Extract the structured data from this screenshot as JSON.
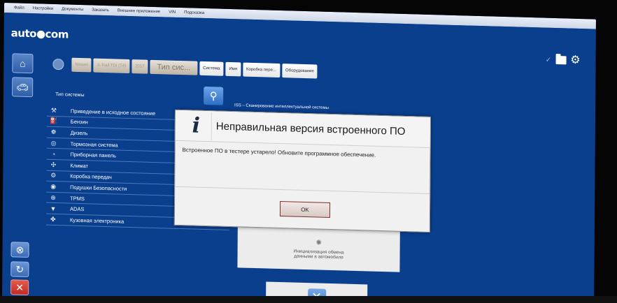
{
  "menu": {
    "items": [
      "Файл",
      "Настройки",
      "Документы",
      "Заказать",
      "Внешнее приложение",
      "VIN",
      "Подсказка"
    ]
  },
  "header": {
    "logo": "auto●com",
    "check_symbol": "✓"
  },
  "breadcrumbs": {
    "items": [
      {
        "label": "Nissan",
        "style": "muted"
      },
      {
        "label": "X-Trail TDI (T4)",
        "style": "muted"
      },
      {
        "label": "2017",
        "style": "muted"
      },
      {
        "label": "Тип сис...",
        "style": "big"
      },
      {
        "label": "Система",
        "style": "white"
      },
      {
        "label": "Имя",
        "style": "white"
      },
      {
        "label": "Коробка пере...",
        "style": "white"
      },
      {
        "label": "Оборудование",
        "style": "white"
      }
    ]
  },
  "systems": {
    "title": "Тип системы",
    "items": [
      {
        "label": "Приведение в исходное состояние",
        "icon": "wrench-icon",
        "glyph": "⚒"
      },
      {
        "label": "Бензин",
        "icon": "fuel-injector-icon",
        "glyph": "⛽"
      },
      {
        "label": "Дизель",
        "icon": "diesel-icon",
        "glyph": "☸"
      },
      {
        "label": "Тормозная система",
        "icon": "brake-disc-icon",
        "glyph": "◎"
      },
      {
        "label": "Приборная панель",
        "icon": "dashboard-icon",
        "glyph": "◔"
      },
      {
        "label": "Климат",
        "icon": "climate-fan-icon",
        "glyph": "✣"
      },
      {
        "label": "Коробка передач",
        "icon": "gearbox-icon",
        "glyph": "⚙"
      },
      {
        "label": "Подушки Безопасности",
        "icon": "airbag-icon",
        "glyph": "◉"
      },
      {
        "label": "TPMS",
        "icon": "tpms-icon",
        "glyph": "⊕"
      },
      {
        "label": "ADAS",
        "icon": "adas-icon",
        "glyph": "▼"
      },
      {
        "label": "Кузовная электроника",
        "icon": "body-electronics-icon",
        "glyph": "✤",
        "extra": "BUS ○"
      }
    ]
  },
  "iss": {
    "text": "ISS – Сканирование интеллектуальной системы",
    "icon": "search-icon"
  },
  "modal": {
    "title": "Неправильная версия встроенного ПО",
    "message": "Встроенное ПО в тестере устарело! Обновите программное обеспечение.",
    "ok_label": "OK",
    "icon": "info-icon"
  },
  "loading": {
    "text": "Инициализация обмена данными в автомобиле"
  },
  "rail": {
    "top_icons": [
      "home-icon",
      "car-icon"
    ],
    "bottom_icons": [
      "help-icon",
      "refresh-icon",
      "exit-icon"
    ]
  },
  "colors": {
    "background": "#0a3f8e",
    "modal": "#f1f1f1",
    "ok_border": "#7a2d28",
    "exit_red": "#d43a2e"
  }
}
